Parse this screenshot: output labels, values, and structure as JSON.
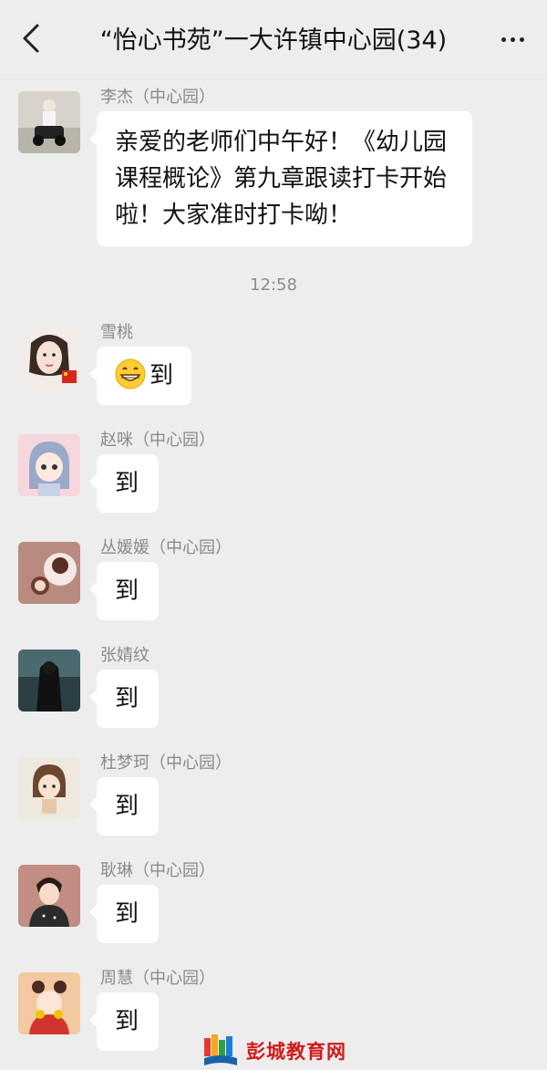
{
  "header": {
    "title": "“怡心书苑”一大许镇中心园(34)",
    "back_icon": "chevron-left-icon",
    "more_icon": "more-horizontal-icon"
  },
  "messages": [
    {
      "sender": "李杰（中心园）",
      "text": "亲爱的老师们中午好！《幼儿园课程概论》第九章跟读打卡开始啦！大家准时打卡呦！"
    },
    {
      "time": "12:58"
    },
    {
      "sender": "雪桃",
      "text": "到",
      "emoji": "grinning-face-icon"
    },
    {
      "sender": "赵咪（中心园）",
      "text": "到"
    },
    {
      "sender": "丛媛媛（中心园）",
      "text": "到"
    },
    {
      "sender": "张婧纹",
      "text": "到"
    },
    {
      "sender": "杜梦珂（中心园）",
      "text": "到"
    },
    {
      "sender": "耿琳（中心园）",
      "text": "到"
    },
    {
      "sender": "周慧（中心园）",
      "text": "到"
    }
  ],
  "watermark": {
    "text": "彭城教育网",
    "icon": "book-logo-icon"
  }
}
